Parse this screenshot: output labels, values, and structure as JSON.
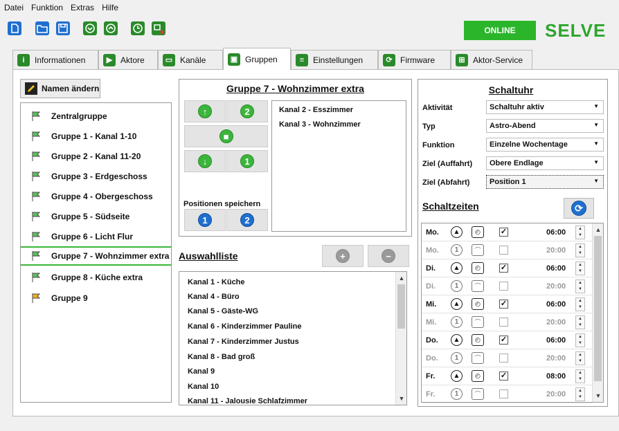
{
  "menu": [
    "Datei",
    "Funktion",
    "Extras",
    "Hilfe"
  ],
  "status": "ONLINE",
  "brand": "SELVE",
  "tabs": [
    "Informationen",
    "Aktore",
    "Kanäle",
    "Gruppen",
    "Einstellungen",
    "Firmware",
    "Aktor-Service"
  ],
  "active_tab": "Gruppen",
  "rename_button": "Namen ändern",
  "groups": [
    "Zentralgruppe",
    "Gruppe 1 - Kanal 1-10",
    "Gruppe 2 - Kanal 11-20",
    "Gruppe 3 - Erdgeschoss",
    "Gruppe 4 - Obergeschoss",
    "Gruppe 5 - Südseite",
    "Gruppe 6 - Licht Flur",
    "Gruppe 7 - Wohnzimmer extra",
    "Gruppe 8 - Küche extra",
    "Gruppe 9"
  ],
  "selected_group": "Gruppe 7 - Wohnzimmer extra",
  "group_panel": {
    "title": "Gruppe 7 - Wohnzimmer extra",
    "channels": [
      "Kanal 2 - Esszimmer",
      "Kanal 3 - Wohnzimmer"
    ],
    "save_positions_label": "Positionen speichern",
    "pos_buttons": [
      "1",
      "2"
    ],
    "intermediate_buttons": [
      "2",
      "1"
    ]
  },
  "selection_list": {
    "title": "Auswahlliste",
    "items": [
      "Kanal 1 - Küche",
      "Kanal 4 - Büro",
      "Kanal 5 - Gäste-WG",
      "Kanal 6 - Kinderzimmer Pauline",
      "Kanal 7 - Kinderzimmer Justus",
      "Kanal 8 - Bad groß",
      "Kanal 9",
      "Kanal 10",
      "Kanal 11 - Jalousie Schlafzimmer"
    ]
  },
  "timer": {
    "title": "Schaltuhr",
    "fields": [
      {
        "label": "Aktivität",
        "value": "Schaltuhr aktiv"
      },
      {
        "label": "Typ",
        "value": "Astro-Abend"
      },
      {
        "label": "Funktion",
        "value": "Einzelne Wochentage"
      },
      {
        "label": "Ziel (Auffahrt)",
        "value": "Obere Endlage"
      },
      {
        "label": "Ziel (Abfahrt)",
        "value": "Position 1"
      }
    ],
    "times_title": "Schaltzeiten",
    "schedule": [
      {
        "day": "Mo.",
        "mode": "up",
        "checked": true,
        "time": "06:00",
        "active": true
      },
      {
        "day": "Mo.",
        "mode": "pos1",
        "checked": false,
        "time": "20:00",
        "active": false
      },
      {
        "day": "Di.",
        "mode": "up",
        "checked": true,
        "time": "06:00",
        "active": true
      },
      {
        "day": "Di.",
        "mode": "pos1",
        "checked": false,
        "time": "20:00",
        "active": false
      },
      {
        "day": "Mi.",
        "mode": "up",
        "checked": true,
        "time": "06:00",
        "active": true
      },
      {
        "day": "Mi.",
        "mode": "pos1",
        "checked": false,
        "time": "20:00",
        "active": false
      },
      {
        "day": "Do.",
        "mode": "up",
        "checked": true,
        "time": "06:00",
        "active": true
      },
      {
        "day": "Do.",
        "mode": "pos1",
        "checked": false,
        "time": "20:00",
        "active": false
      },
      {
        "day": "Fr.",
        "mode": "up",
        "checked": true,
        "time": "08:00",
        "active": true
      },
      {
        "day": "Fr.",
        "mode": "pos1",
        "checked": false,
        "time": "20:00",
        "active": false
      }
    ]
  },
  "colors": {
    "accent": "#2bb52b",
    "brand": "#2da52d",
    "blue": "#1f6fd0"
  },
  "icons": [
    "new-file-icon",
    "open-folder-icon",
    "save-icon",
    "down-icon",
    "up-icon",
    "clock-icon",
    "disconnect-icon"
  ]
}
